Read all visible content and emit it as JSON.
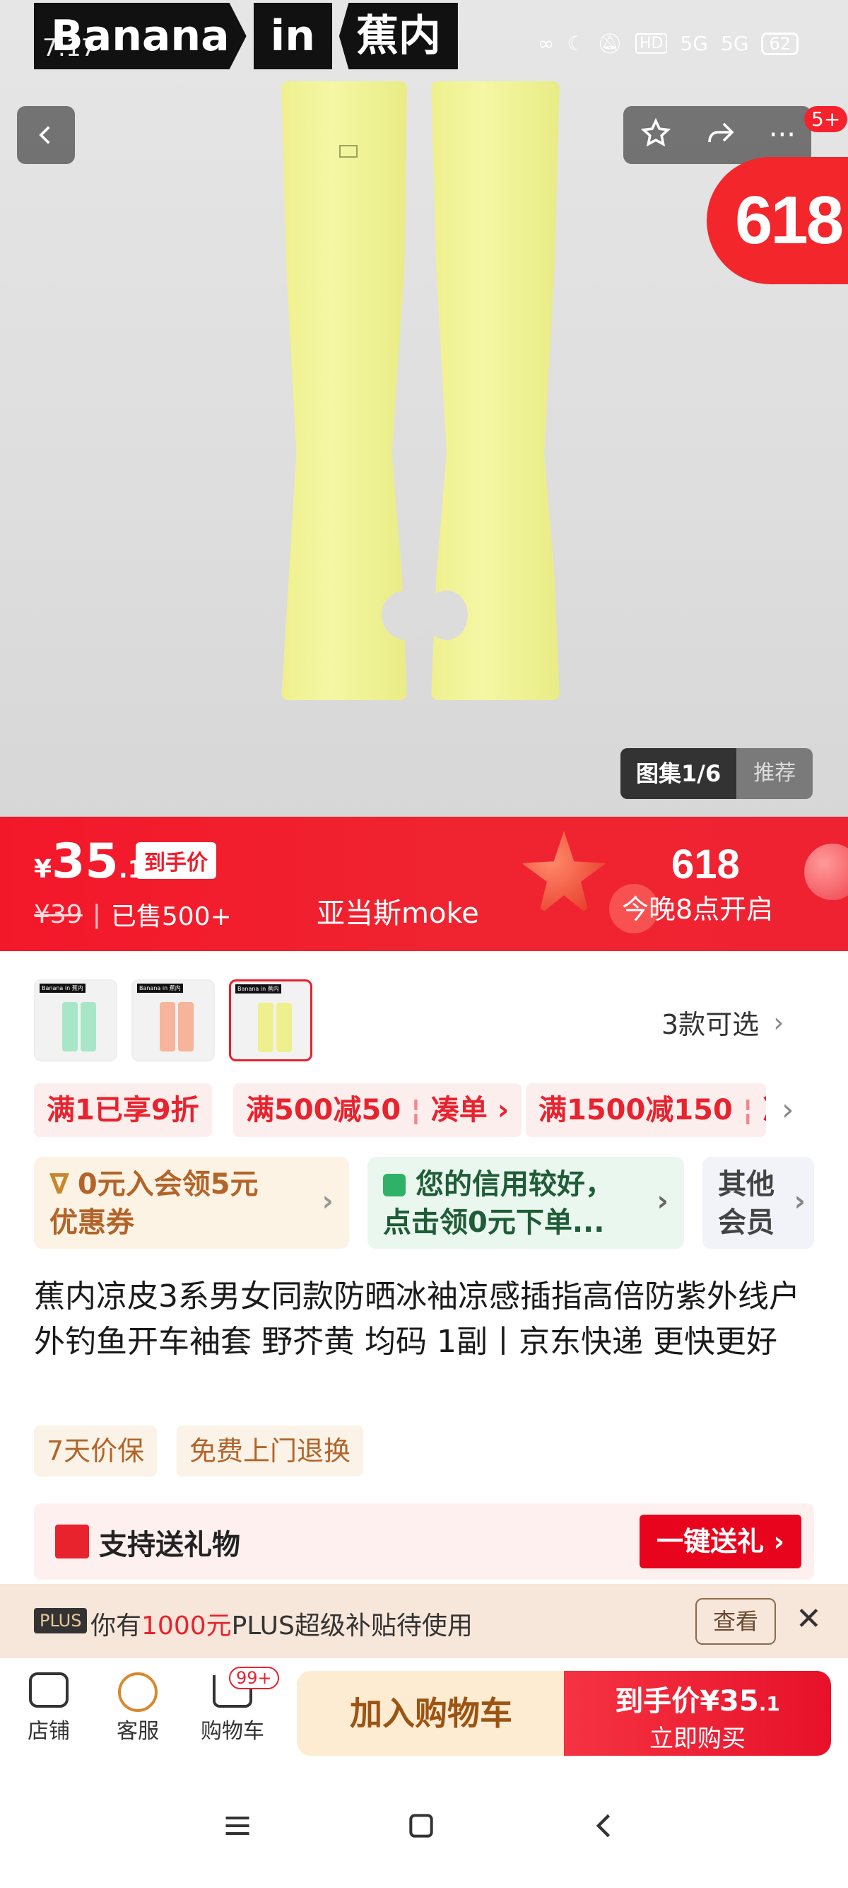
{
  "status_bar": {
    "time": "7:17",
    "battery": "62",
    "signal_1": "5G",
    "signal_2": "5G",
    "hd": "HD"
  },
  "brand_banner": {
    "part1": "Banana",
    "part2": "in",
    "part3": "蕉内"
  },
  "header_icons": {
    "back": "chevron-left-icon",
    "favorite": "star-icon",
    "share": "share-icon",
    "more": "more-icon",
    "more_badge": "5+"
  },
  "promo_badge": "618",
  "gallery": {
    "label": "图集1/6",
    "recommend": "推荐"
  },
  "price_bar": {
    "currency": "¥",
    "price_int": "35",
    "price_dec": ".1",
    "price_tag": "到手价",
    "original_price": "¥39",
    "sold": "已售500+",
    "brand_name": "亚当斯moke",
    "event_title": "618",
    "event_sub": "今晚8点开启"
  },
  "variants": {
    "count_label": "3款可选",
    "items": [
      "Banana in 蕉内",
      "Banana in 蕉内",
      "Banana in 蕉内"
    ],
    "colors": [
      "#a8e6c8",
      "#f6b49a",
      "#eef08e"
    ]
  },
  "coupons": [
    "满1已享9折",
    "满500减50",
    "凑单",
    "满1500减150",
    "凑"
  ],
  "cards": {
    "member": {
      "line1": "0元入会领5元",
      "line2": "优惠券"
    },
    "credit": {
      "line1": "您的信用较好，",
      "line2": "点击领0元下单..."
    },
    "other": {
      "line1": "其他",
      "line2": "会员"
    }
  },
  "product_title": "蕉内凉皮3系男女同款防晒冰袖凉感插指高倍防紫外线户外钓鱼开车袖套 野芥黄 均码 1副丨京东快递 更快更好",
  "services": [
    "7天价保",
    "免费上门退换"
  ],
  "gift": {
    "label": "支持送礼物",
    "button": "一键送礼"
  },
  "plus_bar": {
    "badge": "PLUS",
    "prefix": "你有",
    "amount": "1000元",
    "suffix": "PLUS超级补贴待使用",
    "button": "查看"
  },
  "bottom_bar": {
    "shop": "店铺",
    "service": "客服",
    "cart": "购物车",
    "cart_badge": "99+",
    "add_cart": "加入购物车",
    "buy_line1_prefix": "到手价",
    "buy_price": "¥35",
    "buy_price_dec": ".1",
    "buy_line2": "立即购买"
  }
}
